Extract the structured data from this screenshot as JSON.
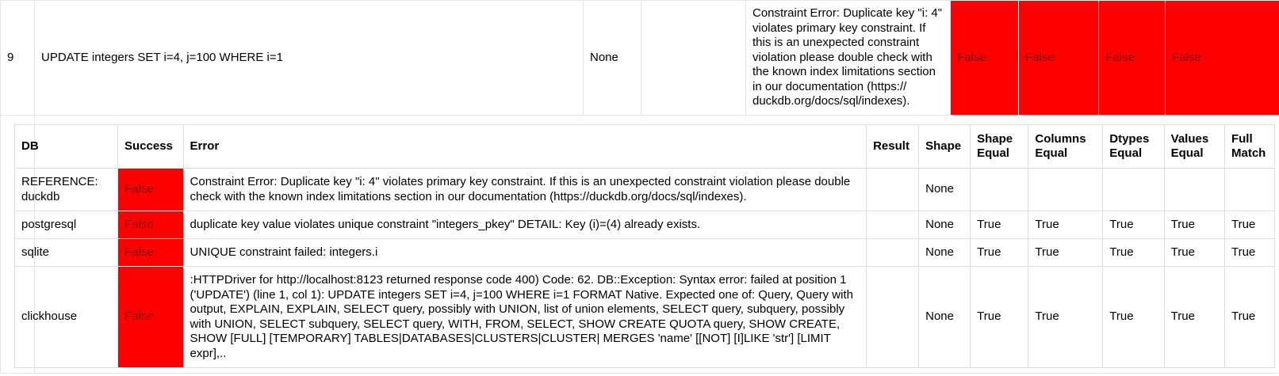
{
  "outer_row": {
    "index": "9",
    "query": "UPDATE integers SET i=4, j=100 WHERE i=1",
    "result": "None",
    "shape": "",
    "error": "Constraint Error: Duplicate key \"i: 4\" violates primary key constraint. If this is an unexpected constraint violation please double check with the known index limitations section in our documentation (https:// duckdb.org/docs/sql/indexes).",
    "flags": [
      "False",
      "False",
      "False",
      "False"
    ]
  },
  "results_table": {
    "headers": [
      "DB",
      "Success",
      "Error",
      "Result",
      "Shape",
      "Shape Equal",
      "Columns Equal",
      "Dtypes Equal",
      "Values Equal",
      "Full Match"
    ],
    "rows": [
      {
        "db": "REFERENCE: duckdb",
        "success": "False",
        "error": "Constraint Error: Duplicate key \"i: 4\" violates primary key constraint. If this is an unexpected constraint violation please double check with the known index limitations section in our documentation (https://duckdb.org/docs/sql/indexes).",
        "result": "",
        "shape": "None",
        "shape_equal": "",
        "columns_equal": "",
        "dtypes_equal": "",
        "values_equal": "",
        "full_match": ""
      },
      {
        "db": "postgresql",
        "success": "False",
        "error": "duplicate key value violates unique constraint \"integers_pkey\" DETAIL: Key (i)=(4) already exists.",
        "result": "",
        "shape": "None",
        "shape_equal": "True",
        "columns_equal": "True",
        "dtypes_equal": "True",
        "values_equal": "True",
        "full_match": "True"
      },
      {
        "db": "sqlite",
        "success": "False",
        "error": "UNIQUE constraint failed: integers.i",
        "result": "",
        "shape": "None",
        "shape_equal": "True",
        "columns_equal": "True",
        "dtypes_equal": "True",
        "values_equal": "True",
        "full_match": "True"
      },
      {
        "db": "clickhouse",
        "success": "False",
        "error": ":HTTPDriver for http://localhost:8123 returned response code 400) Code: 62. DB::Exception: Syntax error: failed at position 1 ('UPDATE') (line 1, col 1): UPDATE integers SET i=4, j=100 WHERE i=1 FORMAT Native. Expected one of: Query, Query with output, EXPLAIN, EXPLAIN, SELECT query, possibly with UNION, list of union elements, SELECT query, subquery, possibly with UNION, SELECT subquery, SELECT query, WITH, FROM, SELECT, SHOW CREATE QUOTA query, SHOW CREATE, SHOW [FULL] [TEMPORARY] TABLES|DATABASES|CLUSTERS|CLUSTER| MERGES 'name' [[NOT] [I]LIKE 'str'] [LIMIT expr],..",
        "result": "",
        "shape": "None",
        "shape_equal": "True",
        "columns_equal": "True",
        "dtypes_equal": "True",
        "values_equal": "True",
        "full_match": "True"
      }
    ]
  },
  "colors": {
    "false_bg": "#ff0000",
    "false_text": "#8a0000",
    "border": "#e4e4e4"
  }
}
